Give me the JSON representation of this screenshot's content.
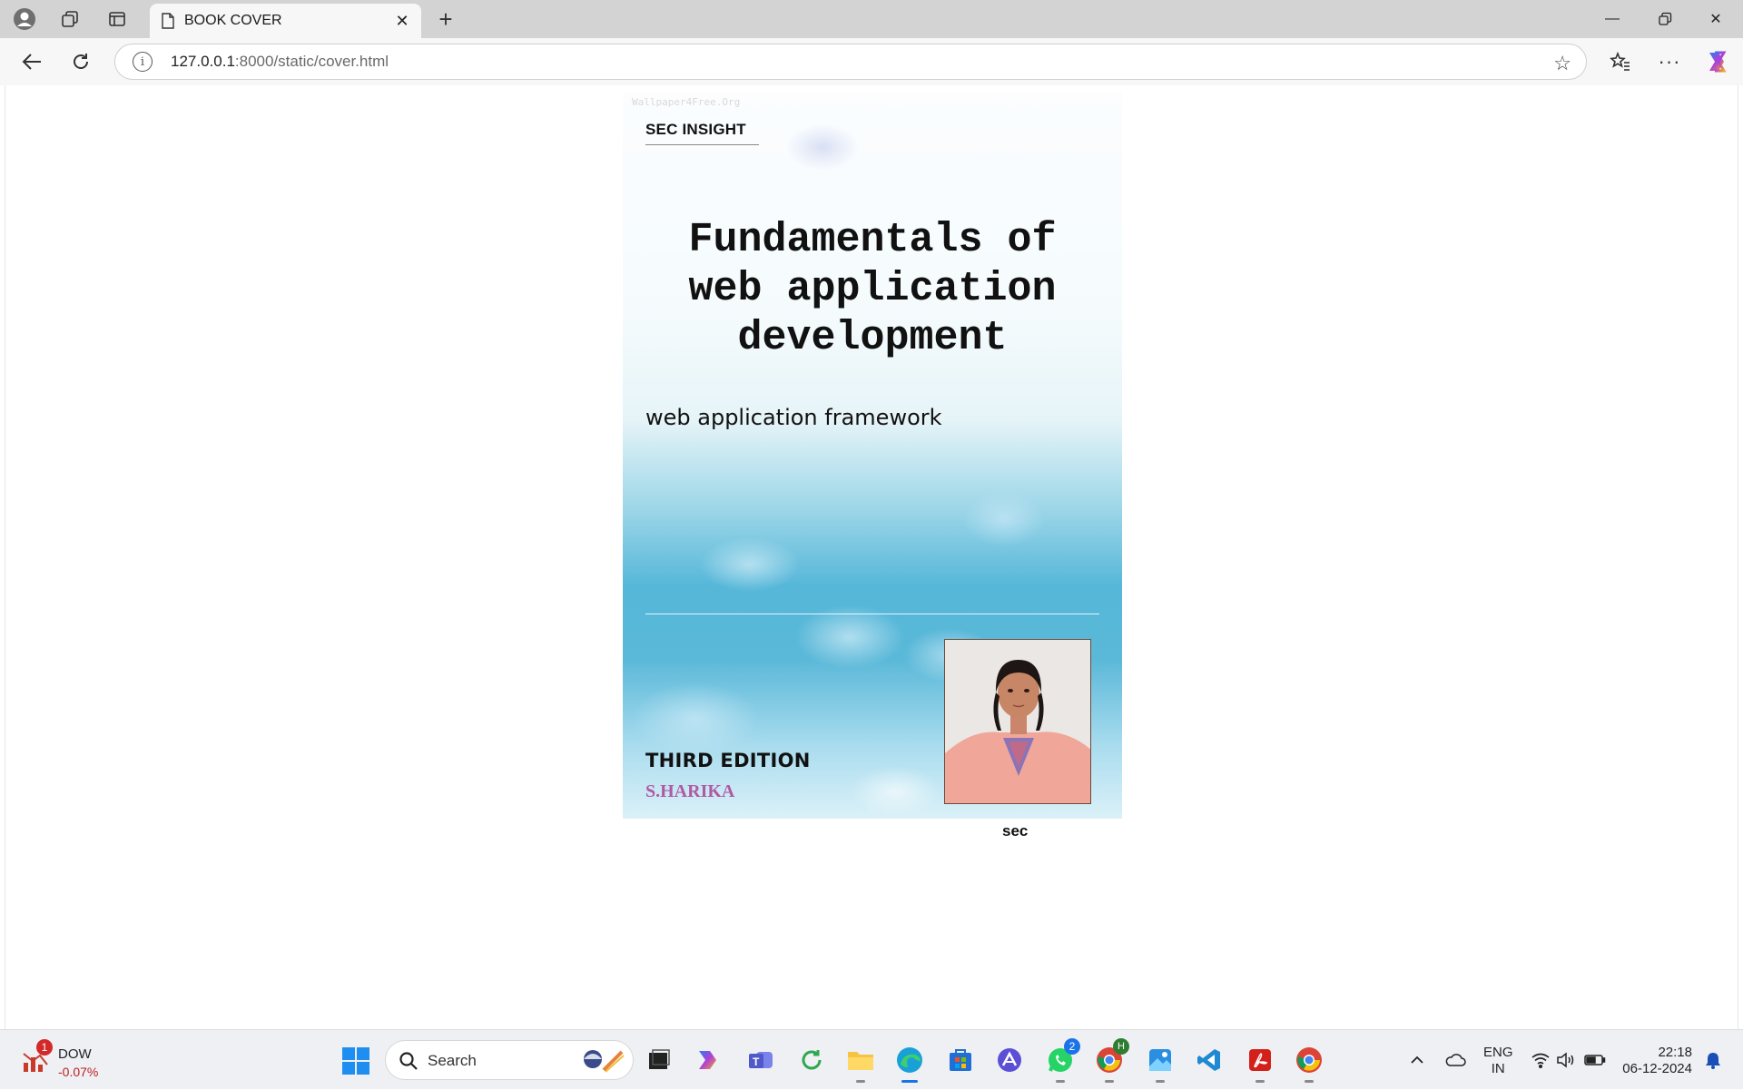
{
  "browser": {
    "tab_title": "BOOK COVER",
    "url_host": "127.0.0.1",
    "url_path": ":8000/static/cover.html"
  },
  "cover": {
    "watermark": "Wallpaper4Free.Org",
    "brand": "SEC INSIGHT",
    "title_line1": "Fundamentals of",
    "title_line2": "web application",
    "title_line3": "development",
    "subtitle": "web application framework",
    "edition": "THIRD EDITION",
    "author": "S.HARIKA",
    "photo_caption": "sec"
  },
  "taskbar": {
    "weather_name": "DOW",
    "weather_value": "-0.07%",
    "weather_badge": "1",
    "search_placeholder": "Search",
    "whatsapp_badge": "2",
    "chrome_badge": "H",
    "lang_line1": "ENG",
    "lang_line2": "IN",
    "time": "22:18",
    "date": "06-12-2024"
  },
  "colors": {
    "author": "#b05aa4",
    "accent": "#1a73e8"
  }
}
